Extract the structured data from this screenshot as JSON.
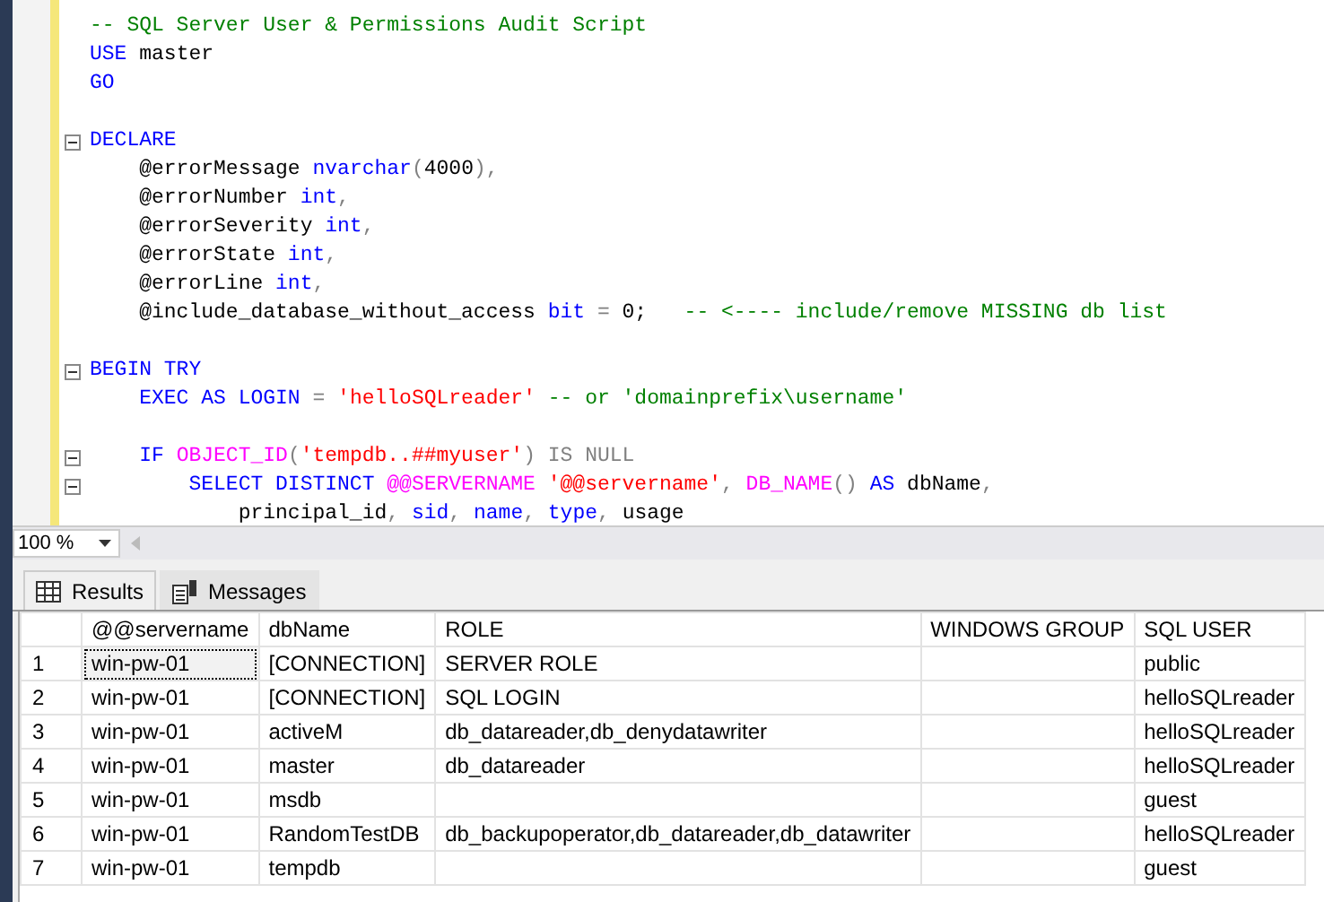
{
  "editor": {
    "lines": [
      {
        "fold": false,
        "tokens": [
          {
            "kind": "comment",
            "text": "-- SQL Server User & Permissions Audit Script"
          }
        ]
      },
      {
        "fold": false,
        "tokens": [
          {
            "kind": "keyword",
            "text": "USE"
          },
          {
            "kind": "plain",
            "text": " master"
          }
        ]
      },
      {
        "fold": false,
        "tokens": [
          {
            "kind": "keyword",
            "text": "GO"
          }
        ]
      },
      {
        "fold": false
      },
      {
        "fold": true,
        "tokens": [
          {
            "kind": "keyword",
            "text": "DECLARE"
          }
        ]
      },
      {
        "fold": false,
        "tokens": [
          {
            "kind": "plain",
            "text": "    @errorMessage "
          },
          {
            "kind": "keyword",
            "text": "nvarchar"
          },
          {
            "kind": "operator",
            "text": "("
          },
          {
            "kind": "plain",
            "text": "4000"
          },
          {
            "kind": "operator",
            "text": "),"
          }
        ]
      },
      {
        "fold": false,
        "tokens": [
          {
            "kind": "plain",
            "text": "    @errorNumber "
          },
          {
            "kind": "keyword",
            "text": "int"
          },
          {
            "kind": "operator",
            "text": ","
          }
        ]
      },
      {
        "fold": false,
        "tokens": [
          {
            "kind": "plain",
            "text": "    @errorSeverity "
          },
          {
            "kind": "keyword",
            "text": "int"
          },
          {
            "kind": "operator",
            "text": ","
          }
        ]
      },
      {
        "fold": false,
        "tokens": [
          {
            "kind": "plain",
            "text": "    @errorState "
          },
          {
            "kind": "keyword",
            "text": "int"
          },
          {
            "kind": "operator",
            "text": ","
          }
        ]
      },
      {
        "fold": false,
        "tokens": [
          {
            "kind": "plain",
            "text": "    @errorLine "
          },
          {
            "kind": "keyword",
            "text": "int"
          },
          {
            "kind": "operator",
            "text": ","
          }
        ]
      },
      {
        "fold": false,
        "tokens": [
          {
            "kind": "plain",
            "text": "    @include_database_without_access "
          },
          {
            "kind": "keyword",
            "text": "bit"
          },
          {
            "kind": "operator",
            "text": " = "
          },
          {
            "kind": "plain",
            "text": "0;   "
          },
          {
            "kind": "comment",
            "text": "-- <---- include/remove MISSING db list"
          }
        ]
      },
      {
        "fold": false
      },
      {
        "fold": true,
        "tokens": [
          {
            "kind": "keyword",
            "text": "BEGIN TRY"
          }
        ]
      },
      {
        "fold": false,
        "tokens": [
          {
            "kind": "keyword",
            "text": "    EXEC AS LOGIN"
          },
          {
            "kind": "operator",
            "text": " = "
          },
          {
            "kind": "string",
            "text": "'helloSQLreader' "
          },
          {
            "kind": "comment",
            "text": "-- or 'domainprefix\\username'"
          }
        ]
      },
      {
        "fold": false
      },
      {
        "fold": true,
        "tokens": [
          {
            "kind": "keyword",
            "text": "    IF "
          },
          {
            "kind": "function",
            "text": "OBJECT_ID"
          },
          {
            "kind": "operator",
            "text": "("
          },
          {
            "kind": "string",
            "text": "'tempdb..##myuser'"
          },
          {
            "kind": "operator",
            "text": ") IS NULL"
          }
        ]
      },
      {
        "fold": true,
        "tokens": [
          {
            "kind": "keyword",
            "text": "        SELECT DISTINCT "
          },
          {
            "kind": "function",
            "text": "@@SERVERNAME "
          },
          {
            "kind": "string",
            "text": "'@@servername'"
          },
          {
            "kind": "operator",
            "text": ", "
          },
          {
            "kind": "function",
            "text": "DB_NAME"
          },
          {
            "kind": "operator",
            "text": "() "
          },
          {
            "kind": "keyword",
            "text": "AS"
          },
          {
            "kind": "plain",
            "text": " dbName"
          },
          {
            "kind": "operator",
            "text": ","
          }
        ]
      },
      {
        "fold": false,
        "tokens": [
          {
            "kind": "plain",
            "text": "            principal_id"
          },
          {
            "kind": "operator",
            "text": ", "
          },
          {
            "kind": "keyword",
            "text": "sid"
          },
          {
            "kind": "operator",
            "text": ", "
          },
          {
            "kind": "keyword",
            "text": "name"
          },
          {
            "kind": "operator",
            "text": ", "
          },
          {
            "kind": "keyword",
            "text": "type"
          },
          {
            "kind": "operator",
            "text": ", "
          },
          {
            "kind": "plain",
            "text": "usage"
          }
        ]
      }
    ]
  },
  "zoom": {
    "value": "100 %"
  },
  "tabs": [
    {
      "label": "Results",
      "kind": "grid",
      "selected": true
    },
    {
      "label": "Messages",
      "kind": "messages",
      "selected": false
    }
  ],
  "results": {
    "columns": [
      "@@servername",
      "dbName",
      "ROLE",
      "WINDOWS GROUP",
      "SQL USER"
    ],
    "rows": [
      {
        "number": "1",
        "focused": true,
        "cells": [
          "win-pw-01",
          "[CONNECTION]",
          "SERVER ROLE",
          "",
          "public"
        ]
      },
      {
        "number": "2",
        "focused": false,
        "cells": [
          "win-pw-01",
          "[CONNECTION]",
          "SQL LOGIN",
          "",
          "helloSQLreader"
        ]
      },
      {
        "number": "3",
        "focused": false,
        "cells": [
          "win-pw-01",
          "activeM",
          "db_datareader,db_denydatawriter",
          "",
          "helloSQLreader"
        ]
      },
      {
        "number": "4",
        "focused": false,
        "cells": [
          "win-pw-01",
          "master",
          "db_datareader",
          "",
          "helloSQLreader"
        ]
      },
      {
        "number": "5",
        "focused": false,
        "cells": [
          "win-pw-01",
          "msdb",
          "",
          "",
          "guest"
        ]
      },
      {
        "number": "6",
        "focused": false,
        "cells": [
          "win-pw-01",
          "RandomTestDB",
          "db_backupoperator,db_datareader,db_datawriter",
          "",
          "helloSQLreader"
        ]
      },
      {
        "number": "7",
        "focused": false,
        "cells": [
          "win-pw-01",
          "tempdb",
          "",
          "",
          "guest"
        ]
      }
    ]
  }
}
